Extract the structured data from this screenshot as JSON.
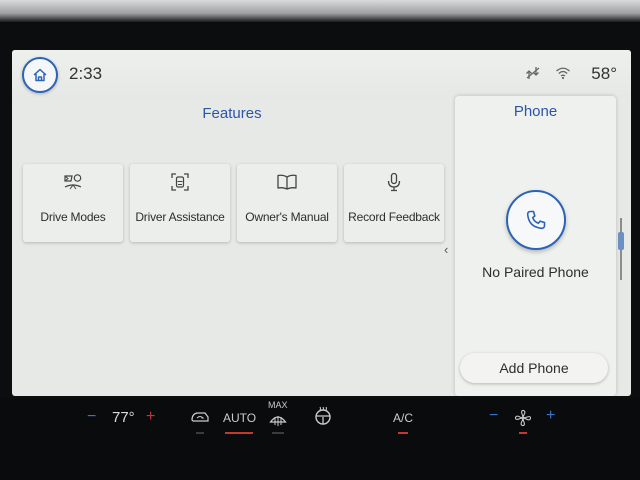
{
  "status_bar": {
    "time": "2:33",
    "temperature": "58°",
    "icons": [
      "home-icon",
      "signal-off-icon",
      "wifi-icon"
    ]
  },
  "features": {
    "title": "Features",
    "tiles": [
      {
        "label": "Drive Modes",
        "icon": "drive-modes-icon"
      },
      {
        "label": "Driver Assistance",
        "icon": "driver-assist-icon"
      },
      {
        "label": "Owner's Manual",
        "icon": "book-icon"
      },
      {
        "label": "Record Feedback",
        "icon": "microphone-icon"
      }
    ],
    "chevron": "‹"
  },
  "phone": {
    "title": "Phone",
    "status": "No Paired Phone",
    "add_label": "Add Phone",
    "icon": "phone-icon"
  },
  "climate": {
    "minus": "−",
    "plus": "+",
    "driver_temp": "77°",
    "auto_label": "AUTO",
    "max_label": "MAX",
    "ac_label": "A/C",
    "icons": [
      "recirculation-icon",
      "max-defrost-icon",
      "heated-steering-icon",
      "fan-icon"
    ]
  },
  "colors": {
    "accent": "#2a56a8",
    "indicator_on": "#c4392f",
    "temp_minus": "#3f72c9",
    "temp_plus": "#c4392f"
  }
}
